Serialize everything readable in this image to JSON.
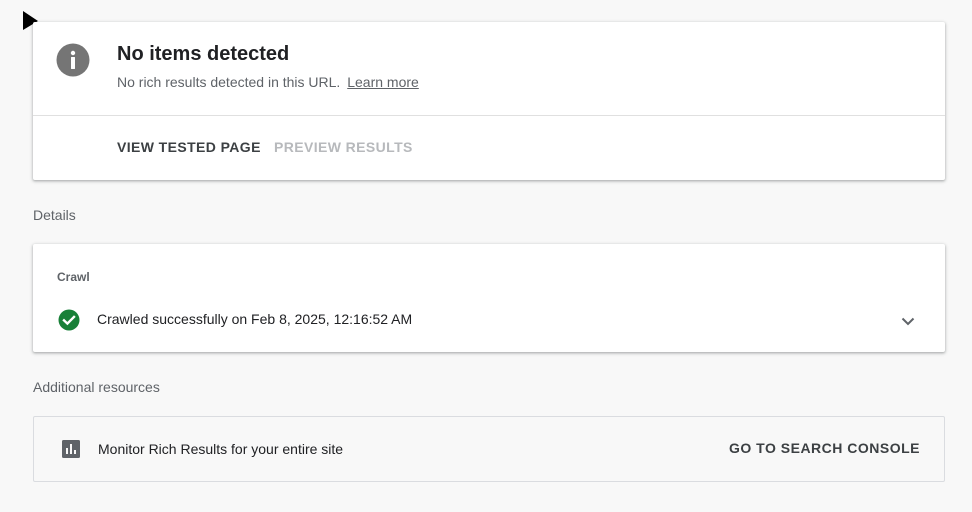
{
  "status": {
    "title": "No items detected",
    "subtitle": "No rich results detected in this URL.",
    "learn_more": "Learn more",
    "icon": "info-icon",
    "actions": {
      "view_tested_page": "VIEW TESTED PAGE",
      "preview_results": "PREVIEW RESULTS"
    }
  },
  "details": {
    "label": "Details",
    "crawl": {
      "heading": "Crawl",
      "status_text": "Crawled successfully on Feb 8, 2025, 12:16:52 AM",
      "icon": "check-circle-icon",
      "expand_icon": "chevron-down-icon"
    }
  },
  "resources": {
    "label": "Additional resources",
    "item_text": "Monitor Rich Results for your entire site",
    "icon": "bar-chart-icon",
    "action": "GO TO SEARCH CONSOLE"
  },
  "colors": {
    "page_background": "#f8f8f8",
    "success_green": "#188038",
    "icon_gray": "#5f6368",
    "disabled_text": "#b7b9bc"
  }
}
